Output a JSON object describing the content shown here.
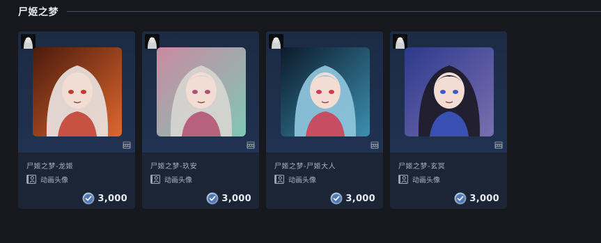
{
  "section": {
    "title": "尸姬之梦"
  },
  "items": [
    {
      "name": "尸姬之梦-龙姬",
      "type_label": "动画头像",
      "price": "3,000",
      "palette": {
        "bg1": "#4a1b0e",
        "bg2": "#e0672c",
        "hair": "#e8e2de",
        "accent": "#c23a2a"
      }
    },
    {
      "name": "尸姬之梦-玖安",
      "type_label": "动画头像",
      "price": "3,000",
      "palette": {
        "bg1": "#c98aa1",
        "bg2": "#7fc7b4",
        "hair": "#d7d5d0",
        "accent": "#b24f70"
      }
    },
    {
      "name": "尸姬之梦-尸姬大人",
      "type_label": "动画头像",
      "price": "3,000",
      "palette": {
        "bg1": "#0c1b2a",
        "bg2": "#3c8fb0",
        "hair": "#8fc6dc",
        "accent": "#d13a4d"
      }
    },
    {
      "name": "尸姬之梦-玄冥",
      "type_label": "动画头像",
      "price": "3,000",
      "palette": {
        "bg1": "#2d3a8c",
        "bg2": "#7a6fb0",
        "hair": "#1c1a26",
        "accent": "#3d58c8"
      }
    }
  ]
}
